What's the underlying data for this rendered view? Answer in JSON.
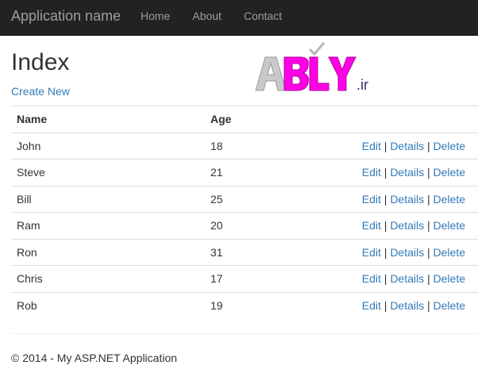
{
  "navbar": {
    "brand": "Application name",
    "links": [
      "Home",
      "About",
      "Contact"
    ]
  },
  "page": {
    "title": "Index",
    "create_link": "Create New"
  },
  "logo": {
    "text": "ABLY",
    "suffix": ".ir",
    "colors": {
      "letters_gray": "#c9c9c9",
      "letters_magenta": "#ff00e6",
      "suffix": "#3a2a7a"
    }
  },
  "table": {
    "headers": {
      "name": "Name",
      "age": "Age"
    },
    "rows": [
      {
        "name": "John",
        "age": "18"
      },
      {
        "name": "Steve",
        "age": "21"
      },
      {
        "name": "Bill",
        "age": "25"
      },
      {
        "name": "Ram",
        "age": "20"
      },
      {
        "name": "Ron",
        "age": "31"
      },
      {
        "name": "Chris",
        "age": "17"
      },
      {
        "name": "Rob",
        "age": "19"
      }
    ],
    "actions": {
      "edit": "Edit",
      "details": "Details",
      "delete": "Delete",
      "separator": "|"
    }
  },
  "footer": {
    "text": "© 2014 - My ASP.NET Application"
  },
  "colors": {
    "navbar_bg": "#222222",
    "nav_text": "#9d9d9d",
    "link": "#337ab7",
    "border": "#dddddd"
  }
}
